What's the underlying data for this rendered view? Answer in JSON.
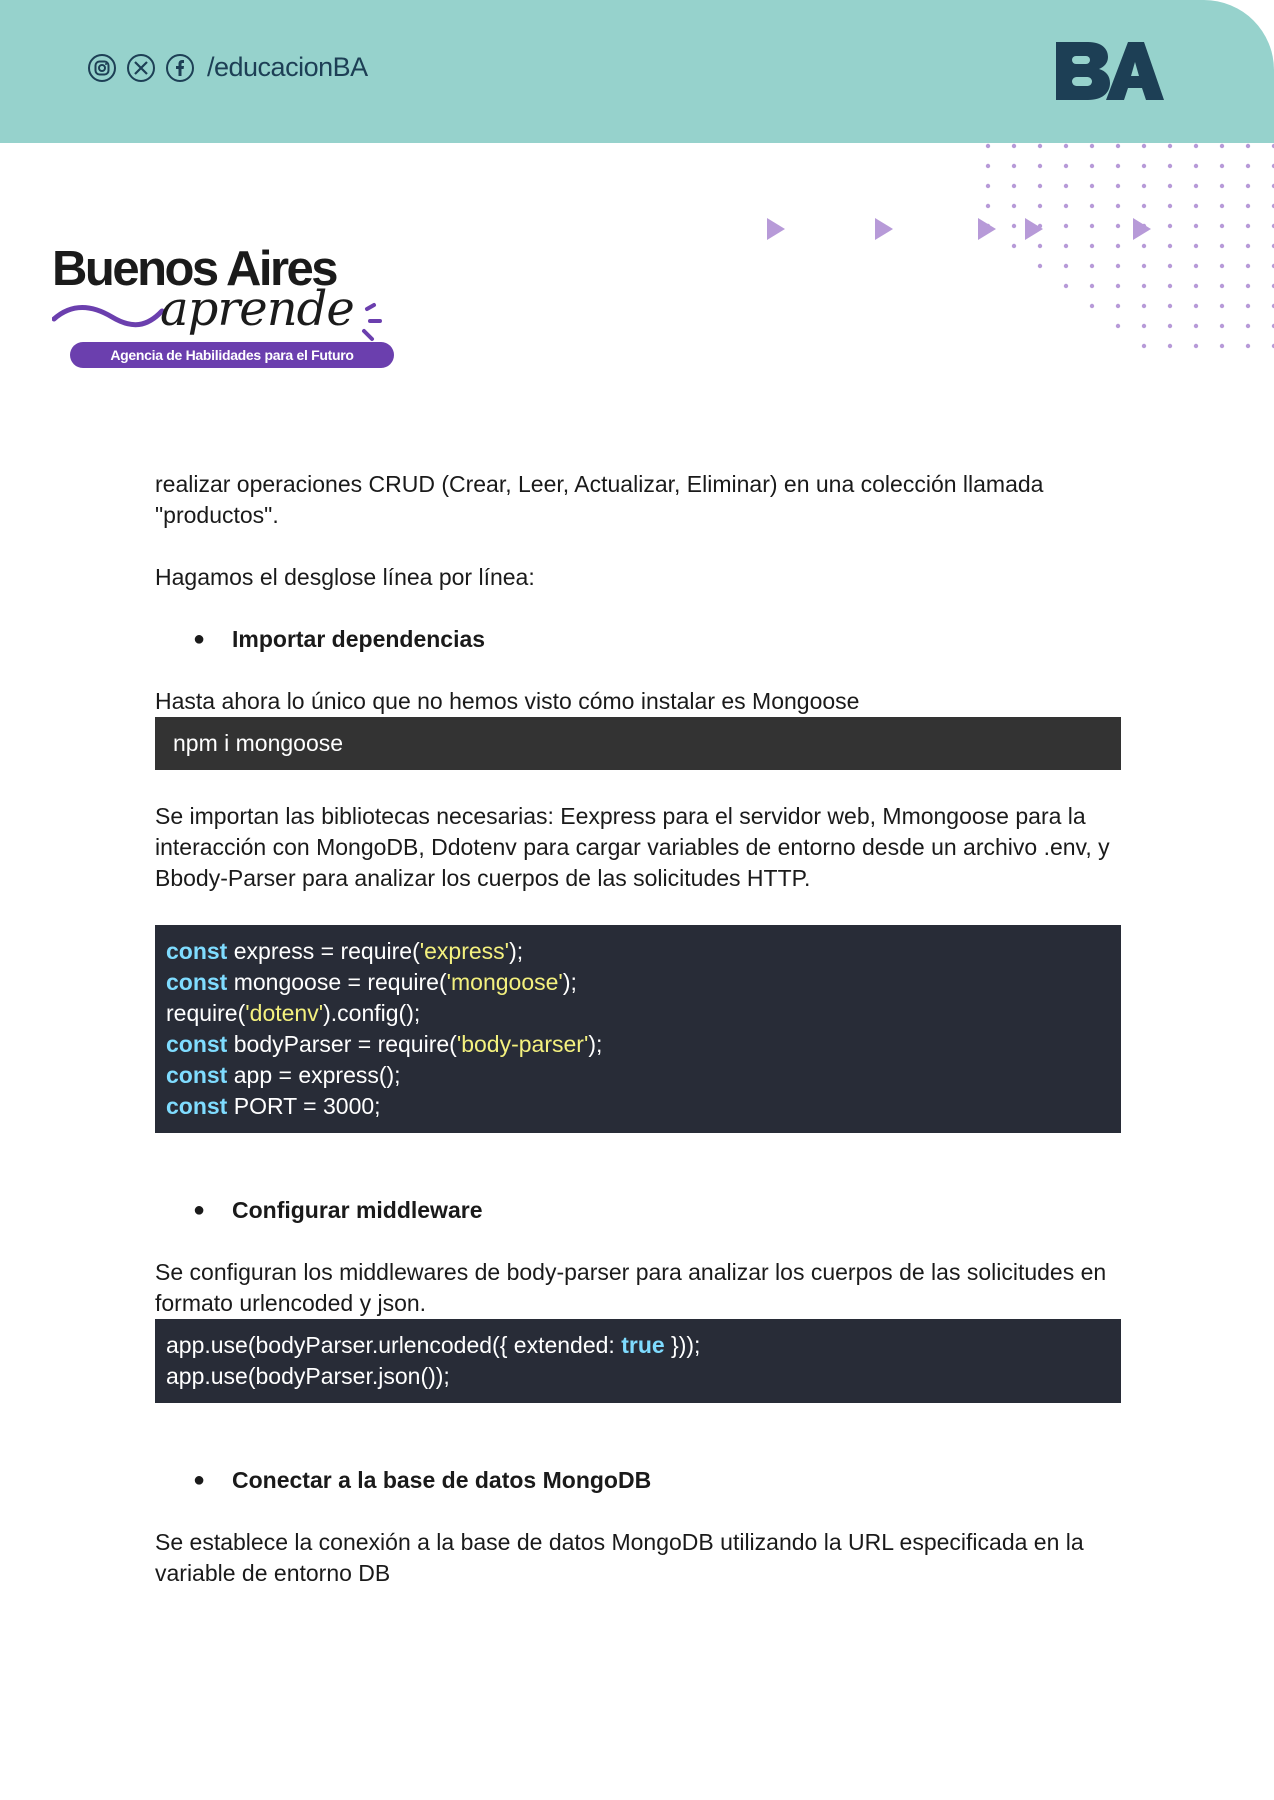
{
  "header": {
    "social_icons": [
      "instagram-icon",
      "x-icon",
      "facebook-icon"
    ],
    "handle": "/educacionBA",
    "brand_logo": "BA",
    "colors": {
      "band": "#96d2cc",
      "logo": "#1d3f55",
      "accent": "#6b3fae",
      "decor": "#b79ad8"
    }
  },
  "logo": {
    "title": "Buenos Aires",
    "script": "aprende",
    "badge": "Agencia de Habilidades para el Futuro"
  },
  "content": {
    "intro": "realizar operaciones CRUD (Crear, Leer, Actualizar, Eliminar) en una colección llamada \"productos\".",
    "breakdown": "Hagamos el  desglose línea por línea:",
    "section1": {
      "heading": "Importar dependencias",
      "note": "Hasta ahora lo único que no hemos visto cómo instalar es Mongoose",
      "command": "npm i mongoose",
      "description": "Se importan las bibliotecas necesarias: Eexpress para el servidor web, Mmongoose para la interacción con MongoDB, Ddotenv para cargar variables de entorno desde un archivo .env, y Bbody-Parser para analizar los cuerpos de las solicitudes HTTP.",
      "code": {
        "l1_kw": "const",
        "l1_a": " express = require(",
        "l1_s": "'express'",
        "l1_b": ");",
        "l2_kw": "const",
        "l2_a": " mongoose = require(",
        "l2_s": "'mongoose'",
        "l2_b": ");",
        "l3_a": "require(",
        "l3_s": "'dotenv'",
        "l3_b": ").config();",
        "l4_kw": "const",
        "l4_a": " bodyParser = require(",
        "l4_s": "'body-parser'",
        "l4_b": ");",
        "l5_kw": "const",
        "l5_a": " app = express();",
        "l6_kw": "const",
        "l6_a": " PORT = 3000;"
      }
    },
    "section2": {
      "heading": "Configurar middleware",
      "description": "Se configuran los middlewares de body-parser para analizar los cuerpos de las solicitudes en formato urlencoded y json.",
      "code": {
        "l1_a": "app.use(bodyParser.urlencoded({ extended: ",
        "l1_kw": "true",
        "l1_b": " }));",
        "l2_a": "app.use(bodyParser.json());"
      }
    },
    "section3": {
      "heading": "Conectar a la base de datos MongoDB",
      "description": "Se establece la conexión a la base de datos MongoDB utilizando la URL especificada en la variable de entorno DB"
    }
  }
}
